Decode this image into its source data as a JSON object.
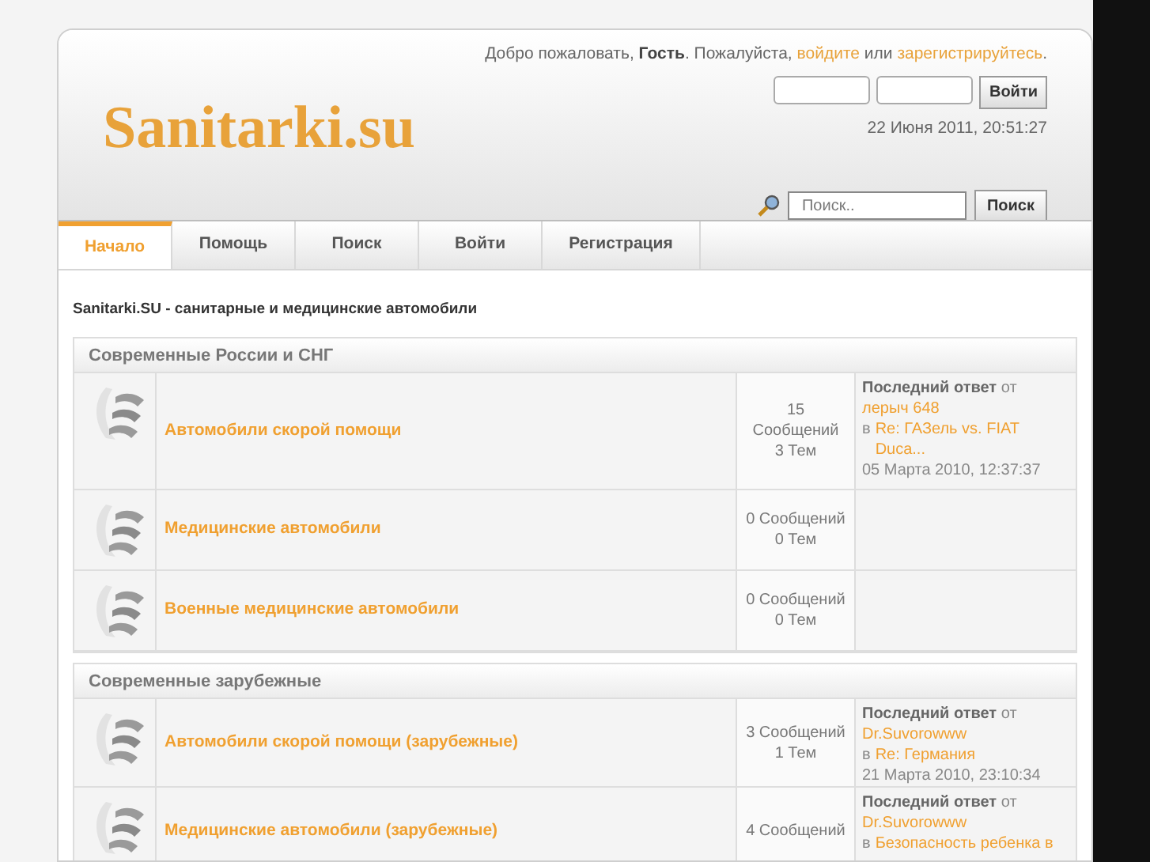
{
  "header": {
    "logo": "Sanitarki.su",
    "greeting": [
      {
        "kind": "text",
        "text": "Добро пожаловать, **Гость**. Пожалуйста,"
      },
      {
        "kind": "link",
        "text": "войдите"
      },
      {
        "kind": "text",
        "text": "или"
      },
      {
        "kind": "link",
        "text": "зарегистрируйтесь"
      },
      {
        "kind": "text",
        "text": "."
      }
    ],
    "login_button": "Войти",
    "datetime": "22 Июня 2011, 20:51:27",
    "search": {
      "placeholder": "Поиск..",
      "button": "Поиск"
    }
  },
  "tabs": [
    {
      "label": "Начало",
      "selected": true
    },
    {
      "label": "Помощь",
      "selected": false
    },
    {
      "label": "Поиск",
      "selected": false
    },
    {
      "label": "Войти",
      "selected": false
    },
    {
      "label": "Регистрация",
      "selected": false
    }
  ],
  "breadcrumb": "Sanitarki.SU - санитарные и медицинские автомобили",
  "categories": [
    {
      "title": "Современные России и СНГ",
      "boards": [
        {
          "name": "Автомобили скорой помощи",
          "stats": [
            "15",
            "Сообщений",
            "3 Тем"
          ],
          "last_post": {
            "label": "Последний ответ",
            "by": "от",
            "author": "лерыч 648",
            "in": "в",
            "topic": "Re: ГАЗель vs. FIAT Duca...",
            "date": "05 Марта 2010, 12:37:37"
          }
        },
        {
          "name": "Медицинские автомобили",
          "stats": [
            "0 Сообщений",
            "0 Тем"
          ]
        },
        {
          "name": "Военные медицинские автомобили",
          "stats": [
            "0 Сообщений",
            "0 Тем"
          ]
        }
      ]
    },
    {
      "title": "Современные зарубежные",
      "boards": [
        {
          "name": "Автомобили скорой помощи (зарубежные)",
          "stats": [
            "3 Сообщений",
            "1 Тем"
          ],
          "last_post": {
            "label": "Последний ответ",
            "by": "от",
            "author": "Dr.Suvorowww",
            "in": "в",
            "topic": "Re: Германия",
            "date": "21 Марта 2010, 23:10:34"
          }
        },
        {
          "name": "Медицинские автомобили (зарубежные)",
          "stats": [
            "4 Сообщений"
          ],
          "last_post": {
            "label": "Последний ответ",
            "by": "от",
            "author": "Dr.Suvorowww",
            "in": "в",
            "topic": "Безопасность ребенка в"
          }
        }
      ]
    }
  ]
}
